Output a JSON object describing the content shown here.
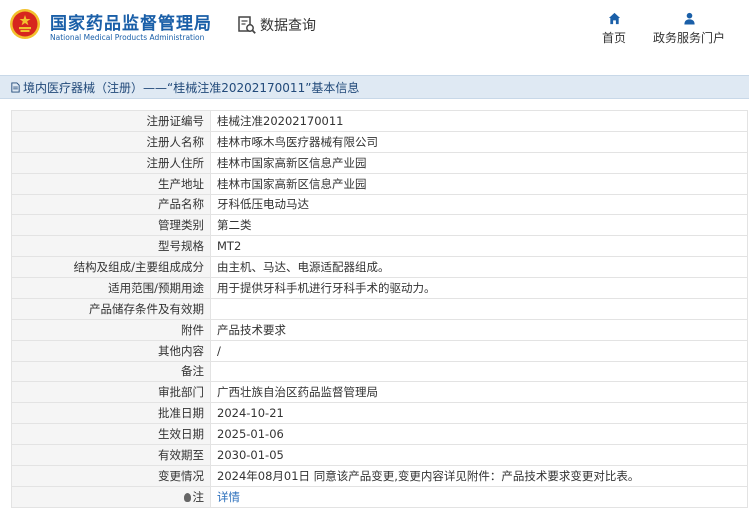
{
  "header": {
    "brand_cn": "国家药品监督管理局",
    "brand_en": "National Medical Products Administration",
    "search_label": "数据查询",
    "nav": {
      "home": "首页",
      "portal": "政务服务门户"
    },
    "colors": {
      "brand": "#1a5fa8",
      "emblem_red": "#d7261e",
      "emblem_gold": "#f2c12e"
    }
  },
  "record_title": "境内医疗器械（注册）——“桂械注准20202170011”基本信息",
  "rows": [
    {
      "label": "注册证编号",
      "value": "桂械注准20202170011"
    },
    {
      "label": "注册人名称",
      "value": "桂林市啄木鸟医疗器械有限公司"
    },
    {
      "label": "注册人住所",
      "value": "桂林市国家高新区信息产业园"
    },
    {
      "label": "生产地址",
      "value": "桂林市国家高新区信息产业园"
    },
    {
      "label": "产品名称",
      "value": "牙科低压电动马达"
    },
    {
      "label": "管理类别",
      "value": "第二类"
    },
    {
      "label": "型号规格",
      "value": "MT2"
    },
    {
      "label": "结构及组成/主要组成成分",
      "value": "由主机、马达、电源适配器组成。"
    },
    {
      "label": "适用范围/预期用途",
      "value": "用于提供牙科手机进行牙科手术的驱动力。"
    },
    {
      "label": "产品储存条件及有效期",
      "value": ""
    },
    {
      "label": "附件",
      "value": "产品技术要求"
    },
    {
      "label": "其他内容",
      "value": "/"
    },
    {
      "label": "备注",
      "value": ""
    },
    {
      "label": "审批部门",
      "value": "广西壮族自治区药品监督管理局"
    },
    {
      "label": "批准日期",
      "value": "2024-10-21"
    },
    {
      "label": "生效日期",
      "value": "2025-01-06"
    },
    {
      "label": "有效期至",
      "value": "2030-01-05"
    },
    {
      "label": "变更情况",
      "value": "2024年08月01日 同意该产品变更,变更内容详见附件：产品技术要求变更对比表。"
    }
  ],
  "note_row": {
    "label": "注",
    "link": "详情"
  }
}
